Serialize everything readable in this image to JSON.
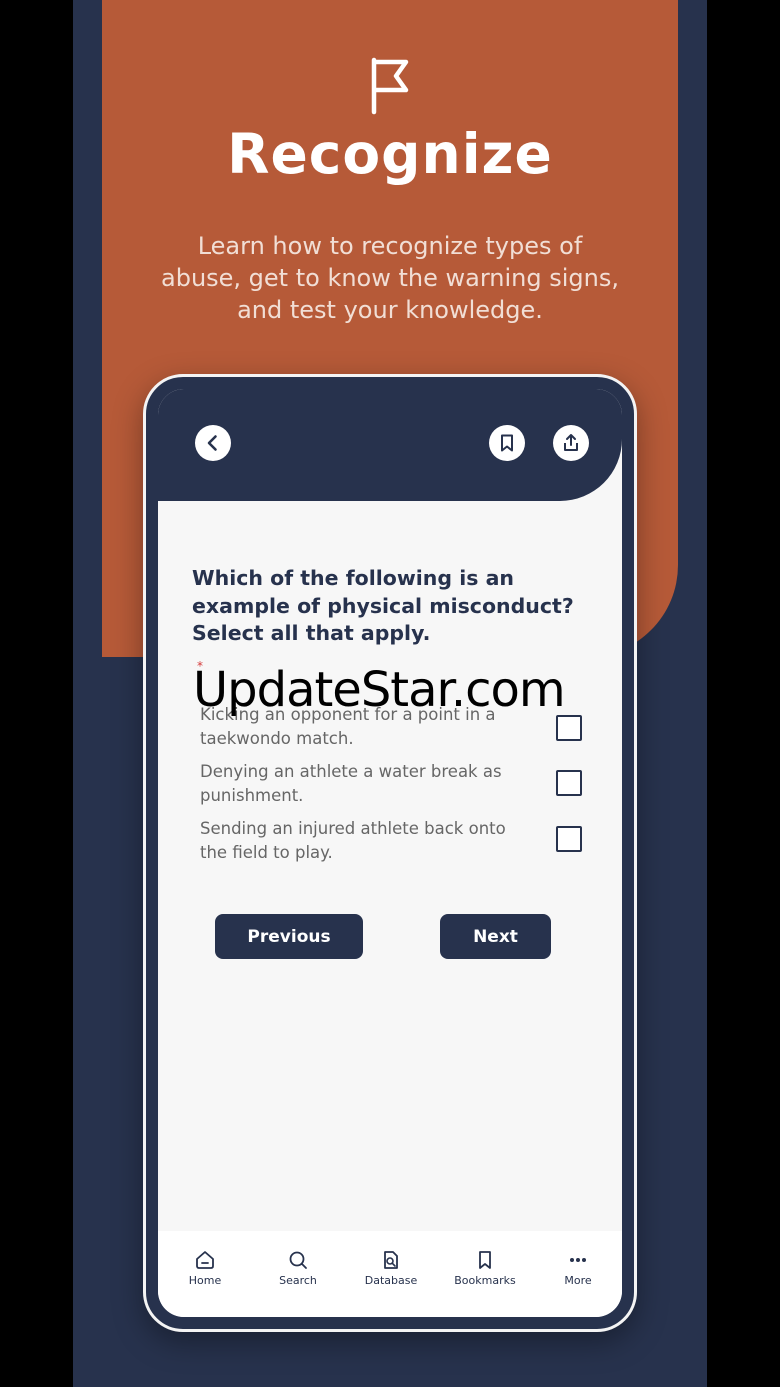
{
  "hero": {
    "icon": "flag-icon",
    "title": "Recognize",
    "subtitle": "Learn how to recognize types of abuse, get to know the warning signs, and test your knowledge."
  },
  "colors": {
    "navy": "#27324d",
    "orange": "#b65a38",
    "screen_bg": "#f7f7f7"
  },
  "app": {
    "appbar": {
      "back_icon": "chevron-left-icon",
      "bookmark_icon": "bookmark-icon",
      "share_icon": "share-icon"
    },
    "question": "Which of the following is an example of physical misconduct? Select all that apply.",
    "required_marker": "*",
    "options": [
      {
        "label": "Kicking an opponent for a point in a taekwondo match.",
        "checked": false
      },
      {
        "label": "Denying an athlete a water break as punishment.",
        "checked": false
      },
      {
        "label": "Sending an injured athlete back onto the field to play.",
        "checked": false
      }
    ],
    "previous_label": "Previous",
    "next_label": "Next",
    "tabs": [
      {
        "label": "Home",
        "icon": "home-icon"
      },
      {
        "label": "Search",
        "icon": "search-icon"
      },
      {
        "label": "Database",
        "icon": "database-icon"
      },
      {
        "label": "Bookmarks",
        "icon": "bookmark-icon"
      },
      {
        "label": "More",
        "icon": "more-icon"
      }
    ]
  },
  "watermark": "UpdateStar.com"
}
